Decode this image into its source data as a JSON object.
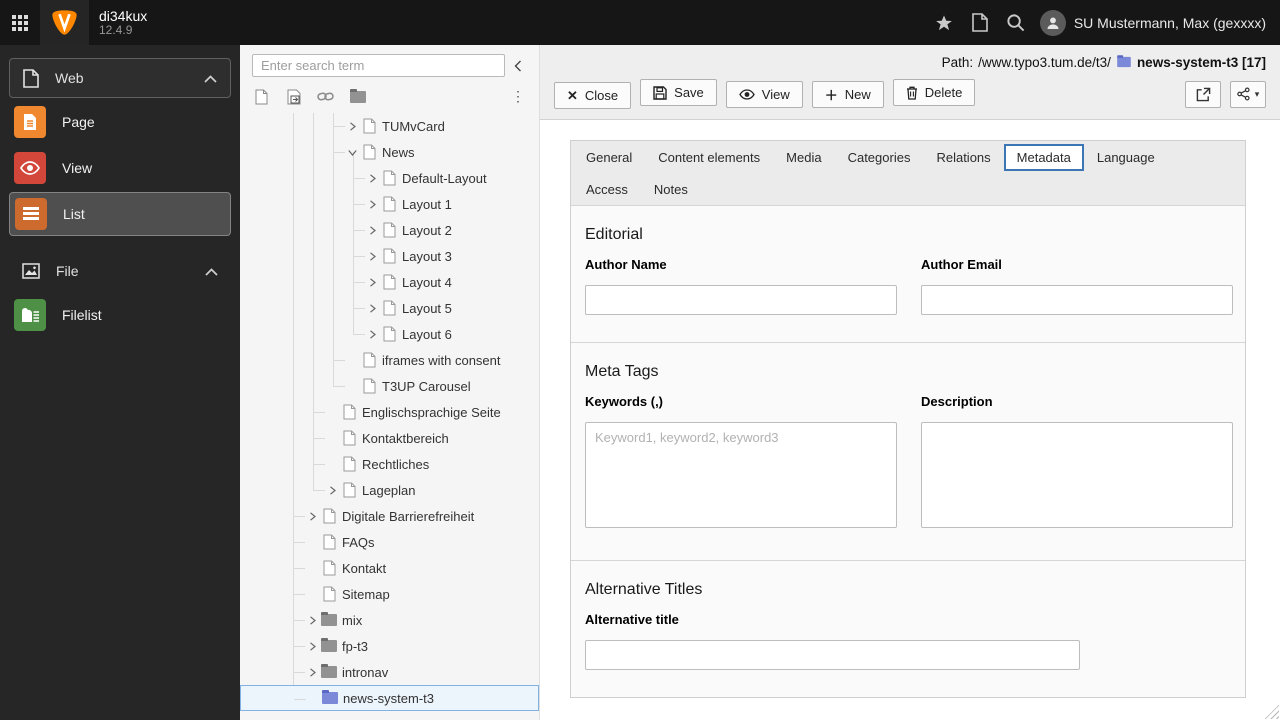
{
  "topbar": {
    "title": "di34kux",
    "version": "12.4.9",
    "user": "SU Mustermann, Max (gexxxx)",
    "icons": [
      "apps-grid",
      "typo3-logo",
      "bookmark-star",
      "document",
      "search",
      "avatar"
    ]
  },
  "module_menu": {
    "groups": [
      {
        "label": "Web",
        "items": [
          {
            "label": "Page",
            "active": false
          },
          {
            "label": "View",
            "active": false
          },
          {
            "label": "List",
            "active": true
          }
        ]
      },
      {
        "label": "File",
        "items": [
          {
            "label": "Filelist",
            "active": false
          }
        ]
      }
    ]
  },
  "pagetree": {
    "search_placeholder": "Enter search term",
    "toolbar_icons": [
      "new-page",
      "page-shortcut",
      "link",
      "folder",
      "more-vertical"
    ],
    "nodes": [
      {
        "label": "TUMvCard",
        "depth": 3,
        "toggle": "collapsed",
        "icon": "page"
      },
      {
        "label": "News",
        "depth": 3,
        "toggle": "expanded",
        "icon": "page"
      },
      {
        "label": "Default-Layout",
        "depth": 4,
        "toggle": "collapsed",
        "icon": "page"
      },
      {
        "label": "Layout 1",
        "depth": 4,
        "toggle": "collapsed",
        "icon": "page"
      },
      {
        "label": "Layout 2",
        "depth": 4,
        "toggle": "collapsed",
        "icon": "page"
      },
      {
        "label": "Layout 3",
        "depth": 4,
        "toggle": "collapsed",
        "icon": "page"
      },
      {
        "label": "Layout 4",
        "depth": 4,
        "toggle": "collapsed",
        "icon": "page"
      },
      {
        "label": "Layout 5",
        "depth": 4,
        "toggle": "collapsed",
        "icon": "page"
      },
      {
        "label": "Layout 6",
        "depth": 4,
        "toggle": "collapsed",
        "icon": "page"
      },
      {
        "label": "iframes with consent",
        "depth": 3,
        "toggle": "none",
        "icon": "page"
      },
      {
        "label": "T3UP Carousel",
        "depth": 3,
        "toggle": "none",
        "icon": "page"
      },
      {
        "label": "Englischsprachige Seite",
        "depth": 2,
        "toggle": "none",
        "icon": "page"
      },
      {
        "label": "Kontaktbereich",
        "depth": 2,
        "toggle": "none",
        "icon": "page"
      },
      {
        "label": "Rechtliches",
        "depth": 2,
        "toggle": "none",
        "icon": "page"
      },
      {
        "label": "Lageplan",
        "depth": 2,
        "toggle": "collapsed",
        "icon": "page"
      },
      {
        "label": "Digitale Barrierefreiheit",
        "depth": 1,
        "toggle": "collapsed",
        "icon": "page"
      },
      {
        "label": "FAQs",
        "depth": 1,
        "toggle": "none",
        "icon": "page"
      },
      {
        "label": "Kontakt",
        "depth": 1,
        "toggle": "none",
        "icon": "page"
      },
      {
        "label": "Sitemap",
        "depth": 1,
        "toggle": "none",
        "icon": "page"
      },
      {
        "label": "mix",
        "depth": 1,
        "toggle": "collapsed",
        "icon": "folder-gray"
      },
      {
        "label": "fp-t3",
        "depth": 1,
        "toggle": "collapsed",
        "icon": "folder-gray"
      },
      {
        "label": "intronav",
        "depth": 1,
        "toggle": "collapsed",
        "icon": "folder-gray"
      },
      {
        "label": "news-system-t3",
        "depth": 1,
        "toggle": "none",
        "icon": "folder-blue",
        "selected": true
      }
    ]
  },
  "docheader": {
    "path_label": "Path:",
    "path_value": "/www.typo3.tum.de/t3/",
    "record": "news-system-t3 [17]",
    "buttons": [
      {
        "label": "Close",
        "icon": "close"
      },
      {
        "label": "Save",
        "icon": "save"
      },
      {
        "label": "View",
        "icon": "view"
      },
      {
        "label": "New",
        "icon": "plus"
      },
      {
        "label": "Delete",
        "icon": "trash"
      }
    ],
    "icon_buttons": [
      {
        "icon": "open-in-window",
        "caret": false
      },
      {
        "icon": "share",
        "caret": true
      }
    ]
  },
  "form": {
    "tabs_row1": [
      {
        "label": "General",
        "active": false
      },
      {
        "label": "Content elements",
        "active": false
      },
      {
        "label": "Media",
        "active": false
      },
      {
        "label": "Categories",
        "active": false
      },
      {
        "label": "Relations",
        "active": false
      },
      {
        "label": "Metadata",
        "active": true
      },
      {
        "label": "Language",
        "active": false
      }
    ],
    "tabs_row2": [
      {
        "label": "Access",
        "active": false
      },
      {
        "label": "Notes",
        "active": false
      }
    ],
    "sections": [
      {
        "heading": "Editorial",
        "fields": [
          {
            "label": "Author Name",
            "type": "input",
            "value": "",
            "placeholder": "",
            "size": "half"
          },
          {
            "label": "Author Email",
            "type": "input",
            "value": "",
            "placeholder": "",
            "size": "half"
          }
        ]
      },
      {
        "heading": "Meta Tags",
        "fields": [
          {
            "label": "Keywords (,)",
            "type": "textarea",
            "value": "",
            "placeholder": "Keyword1, keyword2, keyword3",
            "size": "half"
          },
          {
            "label": "Description",
            "type": "textarea",
            "value": "",
            "placeholder": "",
            "size": "half"
          }
        ]
      },
      {
        "heading": "Alternative Titles",
        "fields": [
          {
            "label": "Alternative title",
            "type": "input",
            "value": "",
            "placeholder": "",
            "size": "wide"
          }
        ]
      }
    ]
  },
  "colors": {
    "typo3_orange": "#ff8700",
    "topbar_bg": "#161616",
    "modulemenu_bg": "#262626",
    "tile_page": "#f0882f",
    "tile_view": "#d2473a",
    "tile_list": "#cd6a2e",
    "tile_filelist": "#4e9146",
    "tree_selected_bg": "#ecf4fc",
    "tree_selected_border": "#82b1e6",
    "active_tab_border": "#3c76b5",
    "folder_blue": "#7c89d8",
    "folder_gray": "#929292"
  }
}
